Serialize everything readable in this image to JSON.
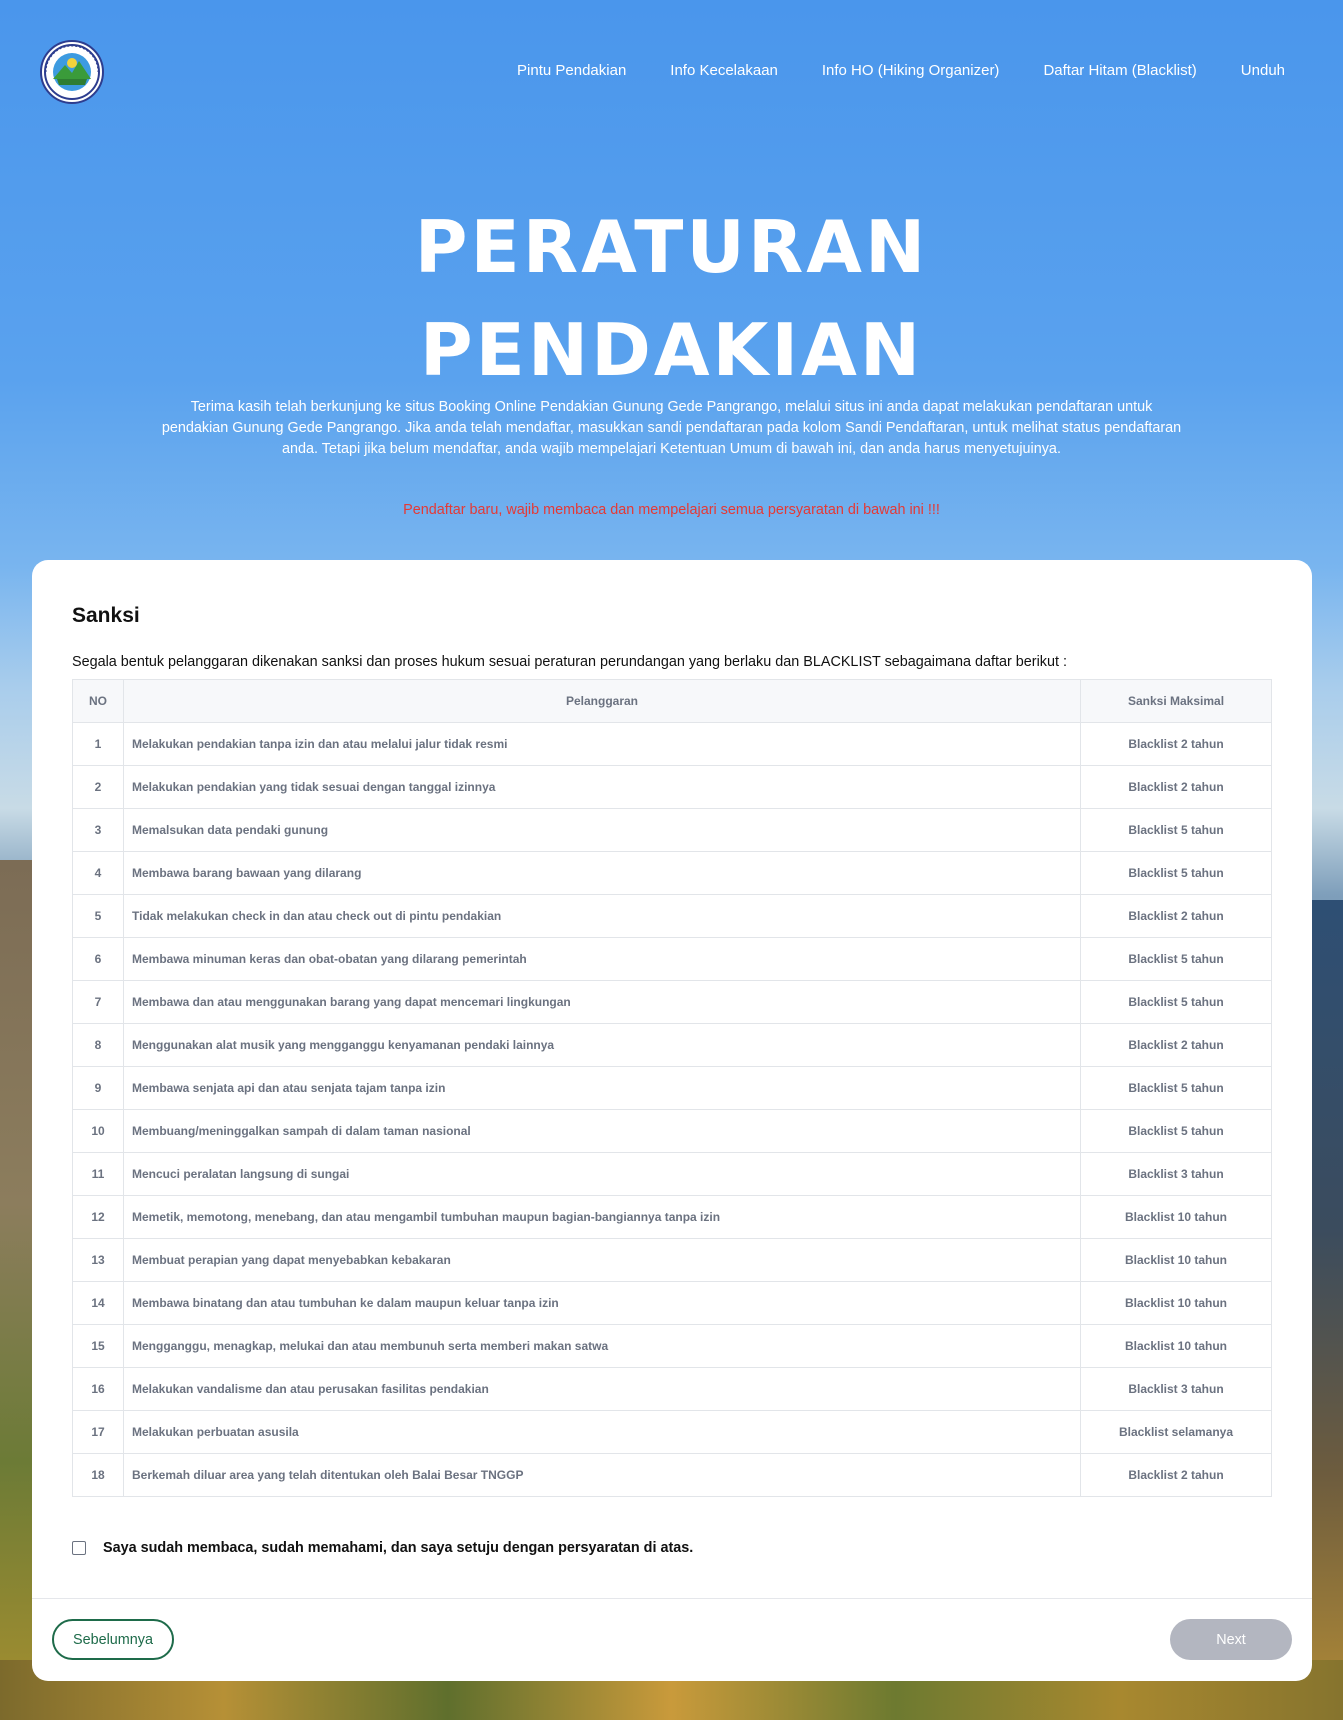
{
  "nav": {
    "items": [
      "Pintu Pendakian",
      "Info Kecelakaan",
      "Info HO (Hiking Organizer)",
      "Daftar Hitam (Blacklist)",
      "Unduh"
    ]
  },
  "hero": {
    "title_line1": "PERATURAN",
    "title_line2": "PENDAKIAN",
    "intro": "Terima kasih telah berkunjung ke situs Booking Online Pendakian Gunung Gede Pangrango, melalui situs ini anda dapat melakukan pendaftaran untuk pendakian Gunung Gede Pangrango. Jika anda telah mendaftar, masukkan sandi pendaftaran pada kolom Sandi Pendaftaran, untuk melihat status pendaftaran anda. Tetapi jika belum mendaftar, anda wajib mempelajari Ketentuan Umum di bawah ini, dan anda harus menyetujuinya.",
    "warning": "Pendaftar baru, wajib membaca dan mempelajari semua persyaratan di bawah ini !!!"
  },
  "section": {
    "title": "Sanksi",
    "description": "Segala bentuk pelanggaran dikenakan sanksi dan proses hukum sesuai peraturan perundangan yang berlaku dan BLACKLIST sebagaimana daftar berikut :"
  },
  "table": {
    "headers": [
      "NO",
      "Pelanggaran",
      "Sanksi Maksimal"
    ],
    "rows": [
      [
        "1",
        "Melakukan pendakian tanpa izin dan atau melalui jalur tidak resmi",
        "Blacklist 2 tahun"
      ],
      [
        "2",
        "Melakukan pendakian yang tidak sesuai dengan tanggal izinnya",
        "Blacklist 2 tahun"
      ],
      [
        "3",
        "Memalsukan data pendaki gunung",
        "Blacklist 5 tahun"
      ],
      [
        "4",
        "Membawa barang bawaan yang dilarang",
        "Blacklist 5 tahun"
      ],
      [
        "5",
        "Tidak melakukan check in dan atau check out di pintu pendakian",
        "Blacklist 2 tahun"
      ],
      [
        "6",
        "Membawa minuman keras dan obat-obatan yang dilarang pemerintah",
        "Blacklist 5 tahun"
      ],
      [
        "7",
        "Membawa dan atau menggunakan barang yang dapat mencemari lingkungan",
        "Blacklist 5 tahun"
      ],
      [
        "8",
        "Menggunakan alat musik yang mengganggu kenyamanan pendaki lainnya",
        "Blacklist 2 tahun"
      ],
      [
        "9",
        "Membawa senjata api dan atau senjata tajam tanpa izin",
        "Blacklist 5 tahun"
      ],
      [
        "10",
        "Membuang/meninggalkan sampah di dalam taman nasional",
        "Blacklist 5 tahun"
      ],
      [
        "11",
        "Mencuci peralatan langsung di sungai",
        "Blacklist 3 tahun"
      ],
      [
        "12",
        "Memetik, memotong, menebang, dan atau mengambil tumbuhan maupun bagian-bangiannya tanpa izin",
        "Blacklist 10 tahun"
      ],
      [
        "13",
        "Membuat perapian yang dapat menyebabkan kebakaran",
        "Blacklist 10 tahun"
      ],
      [
        "14",
        "Membawa binatang dan atau tumbuhan ke dalam maupun keluar tanpa izin",
        "Blacklist 10 tahun"
      ],
      [
        "15",
        "Mengganggu, menagkap, melukai dan atau membunuh serta memberi makan satwa",
        "Blacklist 10 tahun"
      ],
      [
        "16",
        "Melakukan vandalisme dan atau perusakan fasilitas pendakian",
        "Blacklist 3 tahun"
      ],
      [
        "17",
        "Melakukan perbuatan asusila",
        "Blacklist selamanya"
      ],
      [
        "18",
        "Berkemah diluar area yang telah ditentukan oleh Balai Besar TNGGP",
        "Blacklist 2 tahun"
      ]
    ]
  },
  "agreement": {
    "label": "Saya sudah membaca, sudah memahami, dan saya setuju dengan persyaratan di atas.",
    "checked": false
  },
  "buttons": {
    "prev": "Sebelumnya",
    "next": "Next"
  },
  "logo": {
    "icon": "taman-nasional-gede-pangrango-seal"
  },
  "colors": {
    "warning": "#e53935",
    "accent_green": "#1e6b4a",
    "next_disabled": "#b3b6c0"
  }
}
